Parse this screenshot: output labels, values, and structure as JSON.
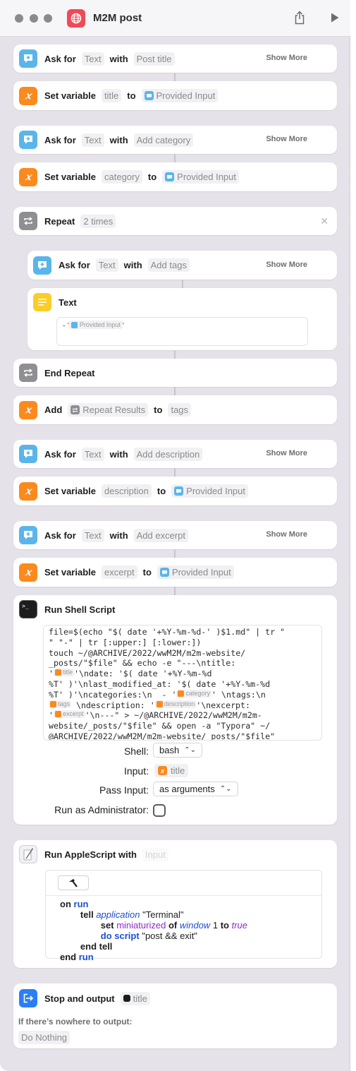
{
  "window": {
    "title": "M2M post"
  },
  "colors": {
    "ask": "#5ab5ea",
    "variable": "#fb8a1e",
    "repeat": "#8e8e93",
    "text": "#fccc28",
    "stop": "#2a7ff5",
    "app": "#ef4b56"
  },
  "common": {
    "ask_for": "Ask for",
    "with": "with",
    "set_variable": "Set variable",
    "to": "to",
    "show_more": "Show More",
    "text_type": "Text",
    "provided_input": "Provided Input"
  },
  "actions": {
    "ask_title_prompt": "Post title",
    "var_title_name": "title",
    "ask_category_prompt": "Add category",
    "var_category_name": "category",
    "repeat_label": "Repeat",
    "repeat_count": "2 times",
    "ask_tags_prompt": "Add tags",
    "text_action_label": "Text",
    "text_prefix": "- '",
    "text_suffix": "'",
    "end_repeat_label": "End Repeat",
    "add_label": "Add",
    "repeat_results": "Repeat Results",
    "tags_var": "tags",
    "ask_description_prompt": "Add description",
    "var_description_name": "description",
    "ask_excerpt_prompt": "Add excerpt",
    "var_excerpt_name": "excerpt"
  },
  "shell": {
    "label": "Run Shell Script",
    "code": {
      "l1": "file=$(echo \"$( date '+%Y-%m-%d-' )$1.md\" | tr \"",
      "l2": "\" \"-\" | tr [:upper:] [:lower:])",
      "l3": "touch ~/@ARCHIVE/2022/wwM2M/m2m-website/",
      "l4": "_posts/\"$file\" && echo -e \"---\\ntitle:",
      "l5a": "'",
      "l5b": "'\\ndate: '$( date '+%Y-%m-%d",
      "l6": "%T' )'\\nlast_modified_at: '$( date '+%Y-%m-%d",
      "l7a": "%T' )'\\ncategories:\\n  - '",
      "l7b": "' \\ntags:\\n",
      "l8b": " \\ndescription: '",
      "l8c": "'\\nexcerpt:",
      "l9a": "'",
      "l9b": "'\\n---\" > ~/@ARCHIVE/2022/wwM2M/m2m-",
      "l10": "website/_posts/\"$file\" && open -a \"Typora\" ~/",
      "l11": "@ARCHIVE/2022/wwM2M/m2m-website/_posts/\"$file\"",
      "tok_title": "title",
      "tok_category": "category",
      "tok_tags": "tags",
      "tok_description": "description",
      "tok_excerpt": "excerpt"
    },
    "shell_label": "Shell:",
    "shell_value": "bash",
    "input_label": "Input:",
    "input_value": "title",
    "pass_label": "Pass Input:",
    "pass_value": "as arguments",
    "admin_label": "Run as Administrator:"
  },
  "applescript": {
    "label": "Run AppleScript with",
    "input_placeholder": "Input",
    "lines": {
      "on": "on",
      "run": "run",
      "tell": "tell",
      "application": "application",
      "terminal": "\"Terminal\"",
      "set": "set",
      "miniaturized": "miniaturized",
      "of": "of",
      "window": "window",
      "one": "1",
      "to": "to",
      "true": "true",
      "do_script": "do script",
      "cmd": "\"post && exit\"",
      "end_tell": "end tell",
      "end": "end"
    }
  },
  "stop": {
    "label": "Stop and output",
    "value": "title",
    "nowhere_label": "If there’s nowhere to output:",
    "nowhere_value": "Do Nothing"
  }
}
